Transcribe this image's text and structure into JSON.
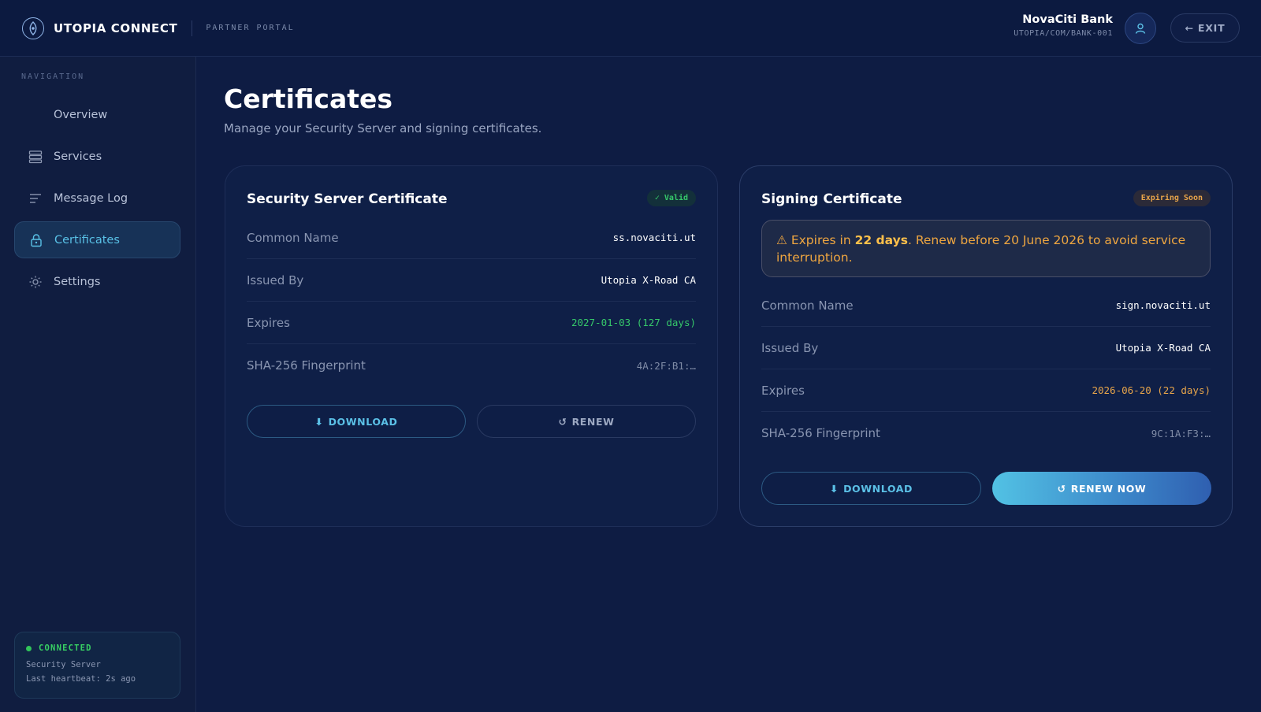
{
  "header": {
    "brand": "UTOPIA CONNECT",
    "subtitle": "PARTNER PORTAL",
    "user_name": "NovaCiti Bank",
    "user_id": "UTOPIA/COM/BANK-001",
    "exit_label": "EXIT",
    "exit_icon": "←"
  },
  "sidebar": {
    "section_label": "NAVIGATION",
    "items": [
      {
        "label": "Overview",
        "icon": "none"
      },
      {
        "label": "Services",
        "icon": "server-stack-icon"
      },
      {
        "label": "Message Log",
        "icon": "lines-icon"
      },
      {
        "label": "Certificates",
        "icon": "lock-icon",
        "active": true
      },
      {
        "label": "Settings",
        "icon": "gear-icon"
      }
    ],
    "status": {
      "title": "CONNECTED",
      "line1": "Security Server",
      "line2": "Last heartbeat: 2s ago"
    }
  },
  "page": {
    "title": "Certificates",
    "subtitle": "Manage your Security Server and signing certificates."
  },
  "cards": {
    "security": {
      "title": "Security Server Certificate",
      "badge": "✓ Valid",
      "rows": [
        {
          "label": "Common Name",
          "value": "ss.novaciti.ut"
        },
        {
          "label": "Issued By",
          "value": "Utopia X-Road CA"
        },
        {
          "label": "Expires",
          "value": "2027-01-03 (127 days)"
        },
        {
          "label": "SHA-256 Fingerprint",
          "value": "4A:2F:B1:…"
        }
      ],
      "download_label": "DOWNLOAD",
      "download_icon": "⬇",
      "renew_label": "RENEW",
      "renew_icon": "↺"
    },
    "signing": {
      "title": "Signing Certificate",
      "badge": "Expiring Soon",
      "alert": {
        "icon": "⚠",
        "prefix": "Expires in ",
        "bold": "22 days",
        "suffix": ". Renew before 20 June 2026 to avoid service interruption."
      },
      "rows": [
        {
          "label": "Common Name",
          "value": "sign.novaciti.ut"
        },
        {
          "label": "Issued By",
          "value": "Utopia X-Road CA"
        },
        {
          "label": "Expires",
          "value": "2026-06-20 (22 days)"
        },
        {
          "label": "SHA-256 Fingerprint",
          "value": "9C:1A:F3:…"
        }
      ],
      "download_label": "DOWNLOAD",
      "download_icon": "⬇",
      "renew_label": "RENEW NOW",
      "renew_icon": "↺"
    }
  },
  "colors": {
    "accent": "#59c1e6",
    "valid": "#36c86a",
    "warning": "#e8a54a",
    "background": "#0e1c43"
  }
}
